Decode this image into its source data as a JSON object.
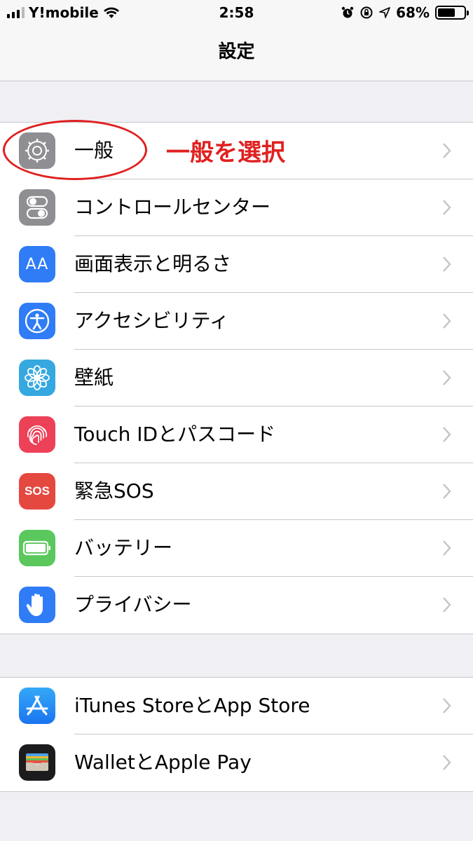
{
  "status_bar": {
    "carrier": "Y!mobile",
    "time": "2:58",
    "battery_percent": "68%",
    "battery_level": 0.68
  },
  "nav": {
    "title": "設定"
  },
  "group1": [
    {
      "label": "一般",
      "icon": "gear-icon",
      "color": "#8e8e93"
    },
    {
      "label": "コントロールセンター",
      "icon": "toggles-icon",
      "color": "#8e8e93"
    },
    {
      "label": "画面表示と明るさ",
      "icon": "text-size-icon",
      "color": "#2f7cf6"
    },
    {
      "label": "アクセシビリティ",
      "icon": "accessibility-icon",
      "color": "#2f7cf6"
    },
    {
      "label": "壁紙",
      "icon": "flower-icon",
      "color": "#36a8e0"
    },
    {
      "label": "Touch IDとパスコード",
      "icon": "fingerprint-icon",
      "color": "#ec4157"
    },
    {
      "label": "緊急SOS",
      "icon": "sos-icon",
      "color": "#e5483f"
    },
    {
      "label": "バッテリー",
      "icon": "battery-icon",
      "color": "#5bc85d"
    },
    {
      "label": "プライバシー",
      "icon": "hand-icon",
      "color": "#2f7cf6"
    }
  ],
  "group2": [
    {
      "label": "iTunes StoreとApp Store",
      "icon": "app-store-icon",
      "color": "#2f8ef6"
    },
    {
      "label": "WalletとApple Pay",
      "icon": "wallet-icon",
      "color": "#1c1c1e"
    }
  ],
  "annotation": {
    "text": "一般を選択",
    "color": "#e02020"
  },
  "icon_text": {
    "aa": "AA",
    "sos": "SOS"
  }
}
